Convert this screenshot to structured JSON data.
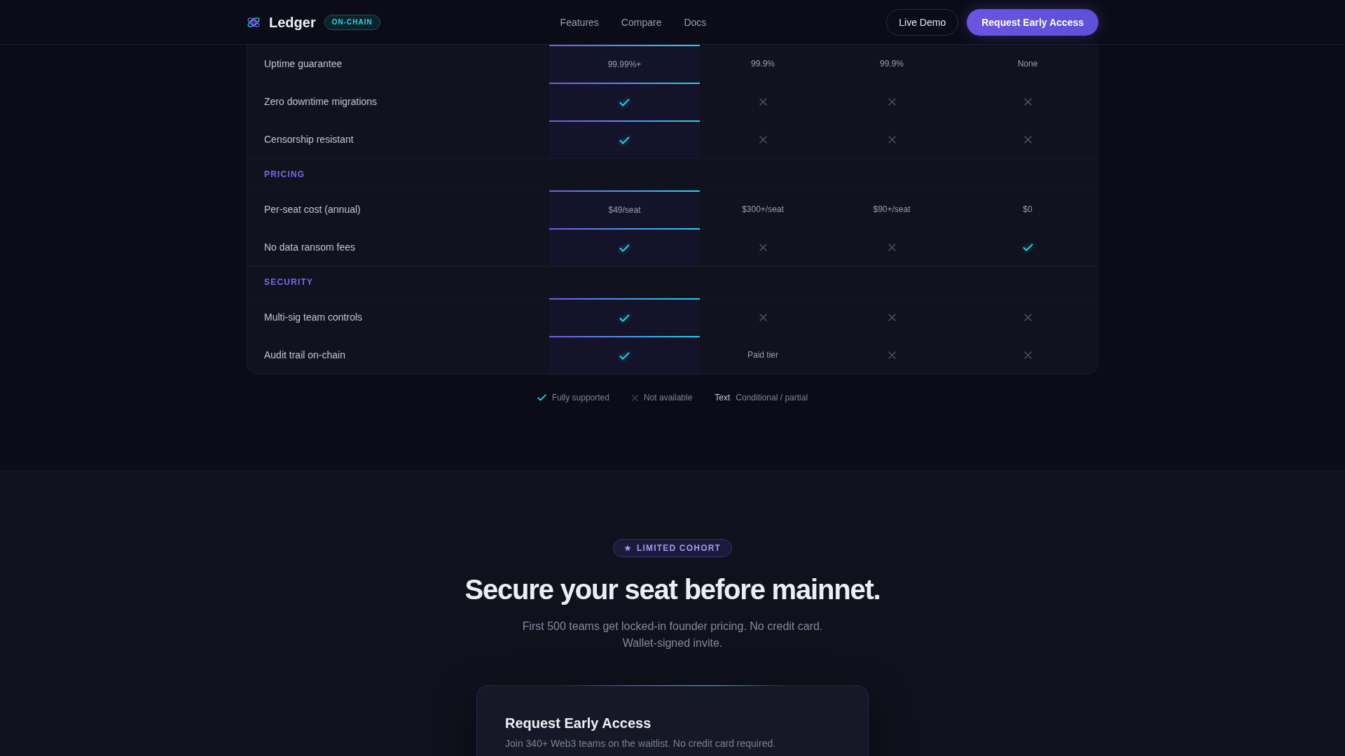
{
  "header": {
    "brand": "Ledger",
    "badge": "ON-CHAIN",
    "links": [
      {
        "label": "Features"
      },
      {
        "label": "Compare"
      },
      {
        "label": "Docs"
      }
    ],
    "buttons": [
      {
        "label": "Live Demo",
        "kind": "secondary"
      },
      {
        "label": "Request Early Access",
        "kind": "primary"
      }
    ]
  },
  "table": {
    "columns": [
      {
        "highlighted": true
      },
      {
        "highlighted": false
      },
      {
        "highlighted": false
      },
      {
        "highlighted": false
      }
    ],
    "groups": [
      {
        "rows": [
          {
            "feature": "Uptime guarantee",
            "cells": [
              {
                "kind": "text",
                "text": "99.99%+"
              },
              {
                "kind": "text",
                "text": "99.9%"
              },
              {
                "kind": "text",
                "text": "99.9%"
              },
              {
                "kind": "text",
                "text": "None"
              }
            ]
          },
          {
            "feature": "Zero downtime migrations",
            "cells": [
              {
                "kind": "check"
              },
              {
                "kind": "cross"
              },
              {
                "kind": "cross"
              },
              {
                "kind": "cross"
              }
            ]
          },
          {
            "feature": "Censorship resistant",
            "cells": [
              {
                "kind": "check"
              },
              {
                "kind": "cross"
              },
              {
                "kind": "cross"
              },
              {
                "kind": "cross"
              }
            ]
          }
        ]
      },
      {
        "title": "PRICING",
        "rows": [
          {
            "feature": "Per-seat cost (annual)",
            "cells": [
              {
                "kind": "text",
                "text": "$49/seat"
              },
              {
                "kind": "text",
                "text": "$300+/seat"
              },
              {
                "kind": "text",
                "text": "$90+/seat"
              },
              {
                "kind": "text",
                "text": "$0"
              }
            ]
          },
          {
            "feature": "No data ransom fees",
            "cells": [
              {
                "kind": "check"
              },
              {
                "kind": "cross"
              },
              {
                "kind": "cross"
              },
              {
                "kind": "check"
              }
            ]
          }
        ]
      },
      {
        "title": "SECURITY",
        "rows": [
          {
            "feature": "Multi-sig team controls",
            "cells": [
              {
                "kind": "check"
              },
              {
                "kind": "cross"
              },
              {
                "kind": "cross"
              },
              {
                "kind": "cross"
              }
            ]
          },
          {
            "feature": "Audit trail on-chain",
            "cells": [
              {
                "kind": "check"
              },
              {
                "kind": "text",
                "text": "Paid tier"
              },
              {
                "kind": "cross"
              },
              {
                "kind": "cross"
              }
            ]
          }
        ]
      }
    ]
  },
  "legend": [
    {
      "kind": "check",
      "label": "Fully supported"
    },
    {
      "kind": "cross",
      "label": "Not available"
    },
    {
      "kind": "text",
      "sample": "Text",
      "label": "Conditional / partial"
    }
  ],
  "cta": {
    "badge": "LIMITED COHORT",
    "title": "Secure your seat before mainnet.",
    "subtitle": "First 500 teams get locked-in founder pricing. No credit card. Wallet-signed invite.",
    "form": {
      "title": "Request Early Access",
      "subtitle": "Join 340+ Web3 teams on the waitlist. No credit card required."
    }
  }
}
